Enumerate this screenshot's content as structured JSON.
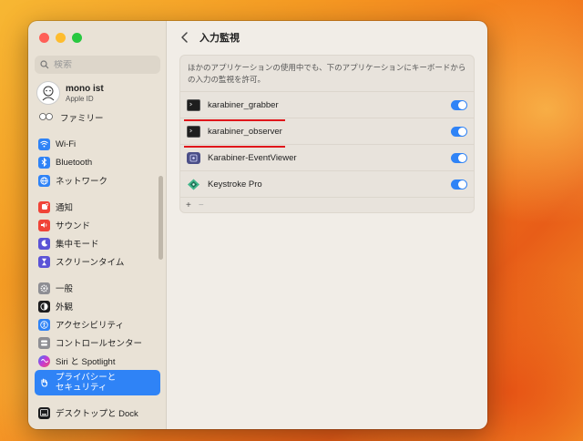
{
  "window": {
    "title": "入力監視"
  },
  "sidebar": {
    "search_placeholder": "検索",
    "account": {
      "name": "mono ist",
      "subtitle": "Apple ID"
    },
    "family_label": "ファミリー",
    "items": [
      {
        "label": "Wi-Fi",
        "icon": "wifi-icon",
        "color": "#2f83f6"
      },
      {
        "label": "Bluetooth",
        "icon": "bluetooth-icon",
        "color": "#2f83f6"
      },
      {
        "label": "ネットワーク",
        "icon": "globe-icon",
        "color": "#2f83f6"
      },
      {
        "label": "通知",
        "icon": "bell-icon",
        "color": "#f04438"
      },
      {
        "label": "サウンド",
        "icon": "speaker-icon",
        "color": "#f04438"
      },
      {
        "label": "集中モード",
        "icon": "moon-icon",
        "color": "#5b53d6"
      },
      {
        "label": "スクリーンタイム",
        "icon": "hourglass-icon",
        "color": "#5b53d6"
      },
      {
        "label": "一般",
        "icon": "gear-icon",
        "color": "#8e8e93"
      },
      {
        "label": "外観",
        "icon": "appearance-icon",
        "color": "#1c1c1e"
      },
      {
        "label": "アクセシビリティ",
        "icon": "accessibility-icon",
        "color": "#2f83f6"
      },
      {
        "label": "コントロールセンター",
        "icon": "control-center-icon",
        "color": "#8e8e93"
      },
      {
        "label": "Siri と Spotlight",
        "icon": "siri-icon",
        "color": "#6e3fd6"
      },
      {
        "label": "プライバシーと\nセキュリティ",
        "icon": "hand-icon",
        "color": "#2f83f6"
      },
      {
        "label": "デスクトップと Dock",
        "icon": "dock-icon",
        "color": "#1c1c1e"
      }
    ]
  },
  "main": {
    "description": "ほかのアプリケーションの使用中でも、下のアプリケーションにキーボードからの入力の監視を許可。",
    "apps": [
      {
        "name": "karabiner_grabber",
        "enabled": true
      },
      {
        "name": "karabiner_observer",
        "enabled": true
      },
      {
        "name": "Karabiner-EventViewer",
        "enabled": true
      },
      {
        "name": "Keystroke Pro",
        "enabled": true
      }
    ],
    "add_label": "+",
    "remove_label": "−"
  }
}
